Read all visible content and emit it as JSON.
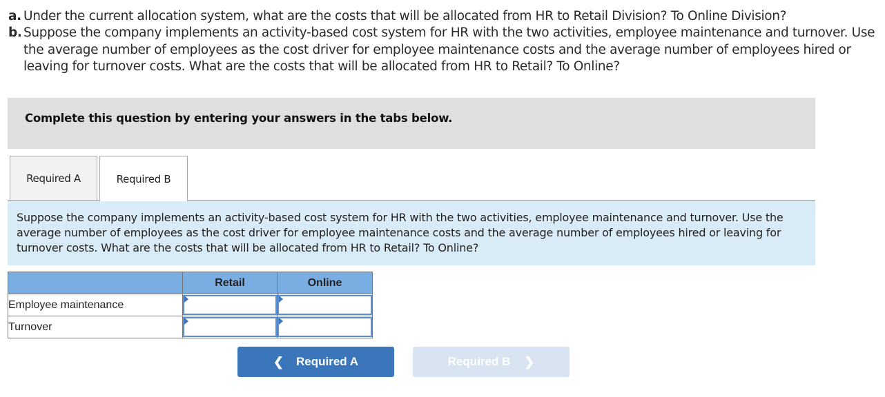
{
  "question": {
    "items": [
      {
        "letter": "a.",
        "text": "Under the current allocation system, what are the costs that will be allocated from HR to Retail Division? To Online Division?"
      },
      {
        "letter": "b.",
        "text": "Suppose the company implements an activity-based cost system for HR with the two activities, employee maintenance and turnover. Use the average number of employees as the cost driver for employee maintenance costs and the average number of employees hired or leaving for turnover costs. What are the costs that will be allocated from HR to Retail? To Online?"
      }
    ]
  },
  "instructions": "Complete this question by entering your answers in the tabs below.",
  "tabs": [
    {
      "label": "Required A",
      "active": false
    },
    {
      "label": "Required B",
      "active": true
    }
  ],
  "prompt": "Suppose the company implements an activity-based cost system for HR with the two activities, employee maintenance and turnover. Use the average number of employees as the cost driver for employee maintenance costs and the average number of employees hired or leaving for turnover costs. What are the costs that will be allocated from HR to Retail? To Online?",
  "table": {
    "headers": [
      "",
      "Retail",
      "Online"
    ],
    "rows": [
      {
        "label": "Employee maintenance",
        "retail": "",
        "online": ""
      },
      {
        "label": "Turnover",
        "retail": "",
        "online": ""
      }
    ]
  },
  "navigation": {
    "prev_label": "Required A",
    "next_label": "Required B",
    "prev_icon": "chevron-left-icon",
    "next_icon": "chevron-right-icon",
    "next_enabled": false
  },
  "colors": {
    "instruction_bg": "#dfdfdf",
    "prompt_bg": "#daebf8",
    "table_header_bg": "#7aaee3",
    "input_border": "#5b8fd6",
    "prev_button_bg": "#3a76b9",
    "next_button_bg_disabled": "#d8e4f1"
  }
}
